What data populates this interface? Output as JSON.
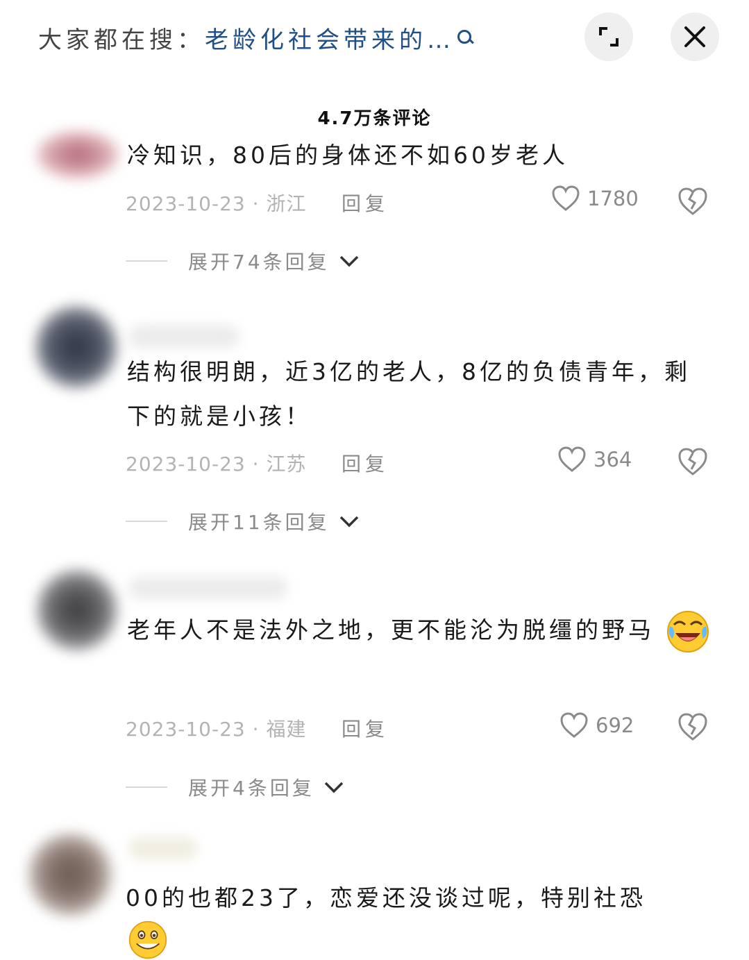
{
  "header": {
    "search_prefix": "大家都在搜：",
    "search_query": "老龄化社会带来的…",
    "icons": {
      "search": "search-icon",
      "expand": "expand-icon",
      "close": "close-icon"
    }
  },
  "comment_count": "4.7万条评论",
  "comments": [
    {
      "text": "冷知识，80后的身体还不如60岁老人",
      "date": "2023-10-23",
      "location": "浙江",
      "reply_label": "回复",
      "likes": "1780",
      "expand_label": "展开74条回复"
    },
    {
      "text": "结构很明朗，近3亿的老人，8亿的负债青年，剩下的就是小孩！",
      "date": "2023-10-23",
      "location": "江苏",
      "reply_label": "回复",
      "likes": "364",
      "expand_label": "展开11条回复"
    },
    {
      "text": "老年人不是法外之地，更不能沦为脱缰的野马",
      "emoji": "laughing-crying-emoji",
      "date": "2023-10-23",
      "location": "福建",
      "reply_label": "回复",
      "likes": "692",
      "expand_label": "展开4条回复"
    },
    {
      "text": "00的也都23了，恋爱还没谈过呢，特别社恐",
      "emoji": "grin-emoji"
    }
  ],
  "separator": " · ",
  "colors": {
    "accent": "#1f4f86",
    "muted": "#8a8a8a",
    "date": "#b3b3b3"
  }
}
